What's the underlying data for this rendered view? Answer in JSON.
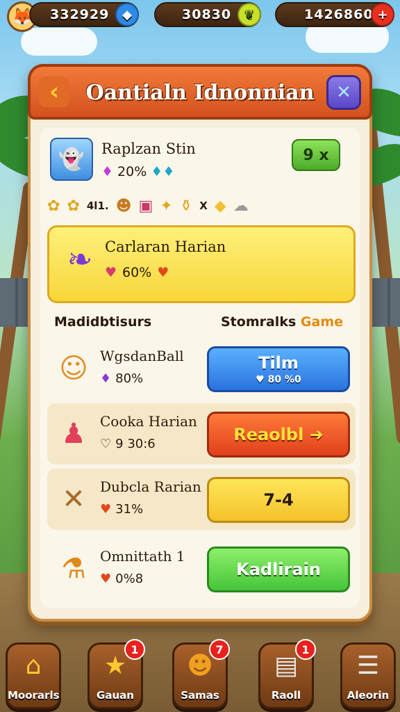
{
  "resources": [
    {
      "value": "332929",
      "badge_icon": "diamond-icon",
      "badge_glyph": "◆",
      "badge_color": "#2f8ae6"
    },
    {
      "value": "30830",
      "badge_icon": "leaf-icon",
      "badge_glyph": "❦",
      "badge_color": "#c8e02a"
    },
    {
      "value": "1426860",
      "badge_icon": "plus-icon",
      "badge_glyph": "+",
      "badge_color": "#e8301e"
    }
  ],
  "header": {
    "title": "Oantialn Idnonnian",
    "back_glyph": "‹",
    "close_glyph": "✕"
  },
  "profile": {
    "name": "Raplzan Stin",
    "stat": "20%",
    "stat_glyph": "♦",
    "extra_glyph": "♦♦",
    "multiplier": "9 x"
  },
  "items_row": {
    "glyphs": [
      "✿",
      "✿",
      "4l1.",
      "☻",
      "▣",
      "✦",
      "⚱",
      "X",
      "◆",
      "☁"
    ]
  },
  "featured": {
    "name": "Carlaran Harian",
    "stat": "60%",
    "stat_glyph": "♥",
    "extra_glyph": "♥",
    "icon": "❧"
  },
  "sections": {
    "left": "Madidbtisurs",
    "right_main": "Stomralks",
    "right_accent": "Game"
  },
  "rows": [
    {
      "name": "WgsdanBall",
      "stat": "80%",
      "stat_glyph": "♦",
      "icon": "☺",
      "button": "Tilm",
      "button_sub": "♥ 80 %0",
      "style": "blue"
    },
    {
      "name": "Cooka Harian",
      "stat": "9 30:6",
      "stat_glyph": "♡",
      "icon": "♟",
      "button": "Reaolbl ➜",
      "button_sub": "",
      "style": "red"
    },
    {
      "name": "Dubcla Rarian",
      "stat": "31%",
      "stat_glyph": "♥",
      "icon": "✕",
      "button": "7-4",
      "button_sub": "",
      "style": "yellow"
    },
    {
      "name": "Omnittath 1",
      "stat": "0%8",
      "stat_glyph": "♥",
      "icon": "⚗",
      "button": "Kadlirain",
      "button_sub": "",
      "style": "green"
    }
  ],
  "nav": [
    {
      "label": "Moorarls",
      "icon": "⌂",
      "badge": ""
    },
    {
      "label": "Gauan",
      "icon": "★",
      "badge": "1"
    },
    {
      "label": "Samas",
      "icon": "☻",
      "badge": "7"
    },
    {
      "label": "Raoll",
      "icon": "▤",
      "badge": "1"
    },
    {
      "label": "Aleorin",
      "icon": "☰",
      "badge": ""
    }
  ]
}
